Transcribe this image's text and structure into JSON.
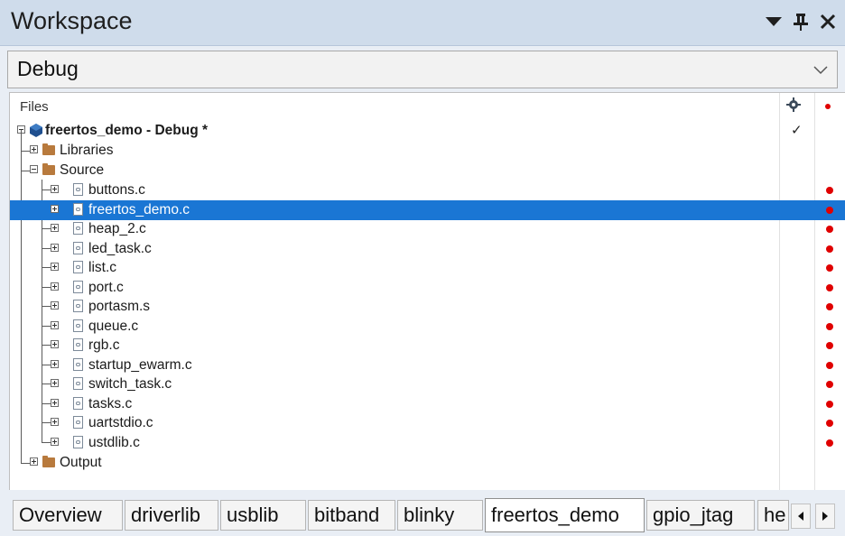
{
  "window": {
    "title": "Workspace",
    "controls": [
      "dropdown-arrow-icon",
      "pin-icon",
      "close-icon"
    ]
  },
  "config": {
    "selected": "Debug"
  },
  "tree": {
    "header": {
      "files": "Files",
      "build_col_icon": "gear-icon",
      "status_col_icon": "red-dot"
    },
    "project": {
      "label": "freertos_demo - Debug *",
      "checked": true
    },
    "folders": {
      "libraries": "Libraries",
      "source": "Source",
      "output": "Output"
    },
    "files": [
      {
        "name": "buttons.c",
        "selected": false
      },
      {
        "name": "freertos_demo.c",
        "selected": true
      },
      {
        "name": "heap_2.c",
        "selected": false
      },
      {
        "name": "led_task.c",
        "selected": false
      },
      {
        "name": "list.c",
        "selected": false
      },
      {
        "name": "port.c",
        "selected": false
      },
      {
        "name": "portasm.s",
        "selected": false
      },
      {
        "name": "queue.c",
        "selected": false
      },
      {
        "name": "rgb.c",
        "selected": false
      },
      {
        "name": "startup_ewarm.c",
        "selected": false
      },
      {
        "name": "switch_task.c",
        "selected": false
      },
      {
        "name": "tasks.c",
        "selected": false
      },
      {
        "name": "uartstdio.c",
        "selected": false
      },
      {
        "name": "ustdlib.c",
        "selected": false
      }
    ],
    "status_color": "#e00000",
    "selection_color": "#1a76d4"
  },
  "tabs": [
    {
      "label": "Overview",
      "active": false
    },
    {
      "label": "driverlib",
      "active": false
    },
    {
      "label": "usblib",
      "active": false
    },
    {
      "label": "bitband",
      "active": false
    },
    {
      "label": "blinky",
      "active": false
    },
    {
      "label": "freertos_demo",
      "active": true
    },
    {
      "label": "gpio_jtag",
      "active": false
    },
    {
      "label": "he",
      "active": false
    }
  ]
}
